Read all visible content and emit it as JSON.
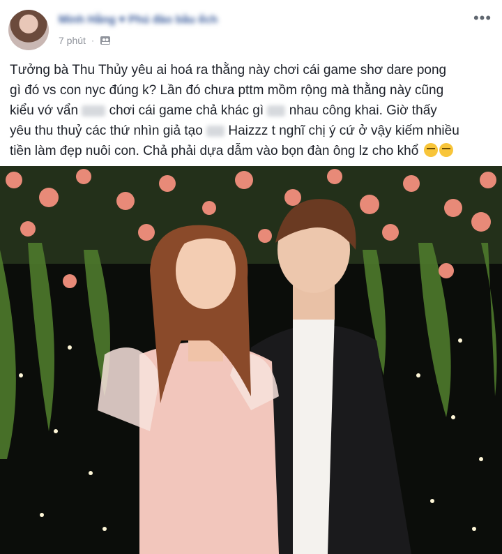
{
  "post": {
    "author_name": "Minh Hằng ♥ Phú đào bầu ếch",
    "time": "7 phút",
    "privacy_icon": "friends-icon",
    "more_icon": "more-options-icon",
    "text_lines": [
      "Tưởng bà Thu Thủy yêu ai hoá ra thằng này chơi cái game shơ dare pong",
      "gì đó vs con nyc đúng k? Lần đó chưa pttm mồm rộng mà thằng này cũng",
      [
        "kiểu vớ vẩn ",
        " chơi cái game chả khác gì ",
        " nhau công khai. Giờ thấy"
      ],
      [
        "yêu thu thuỷ các thứ nhìn giả tạo ",
        " Haizzz t nghĩ chị ý cứ ở vậy kiếm nhiều"
      ],
      "tiền làm đẹp nuôi con. Chả phải dựa dẫm vào bọn đàn ông lz cho khổ"
    ],
    "emoji": "expressionless-face-emoji"
  },
  "photo": {
    "description_icon": "couple-photo",
    "colors": {
      "background": "#0b0d0a",
      "flowers": "#e88a78",
      "leaves": "#4e7a2c",
      "dress": "#f2c6bc",
      "jacket": "#1a1a1c"
    }
  }
}
